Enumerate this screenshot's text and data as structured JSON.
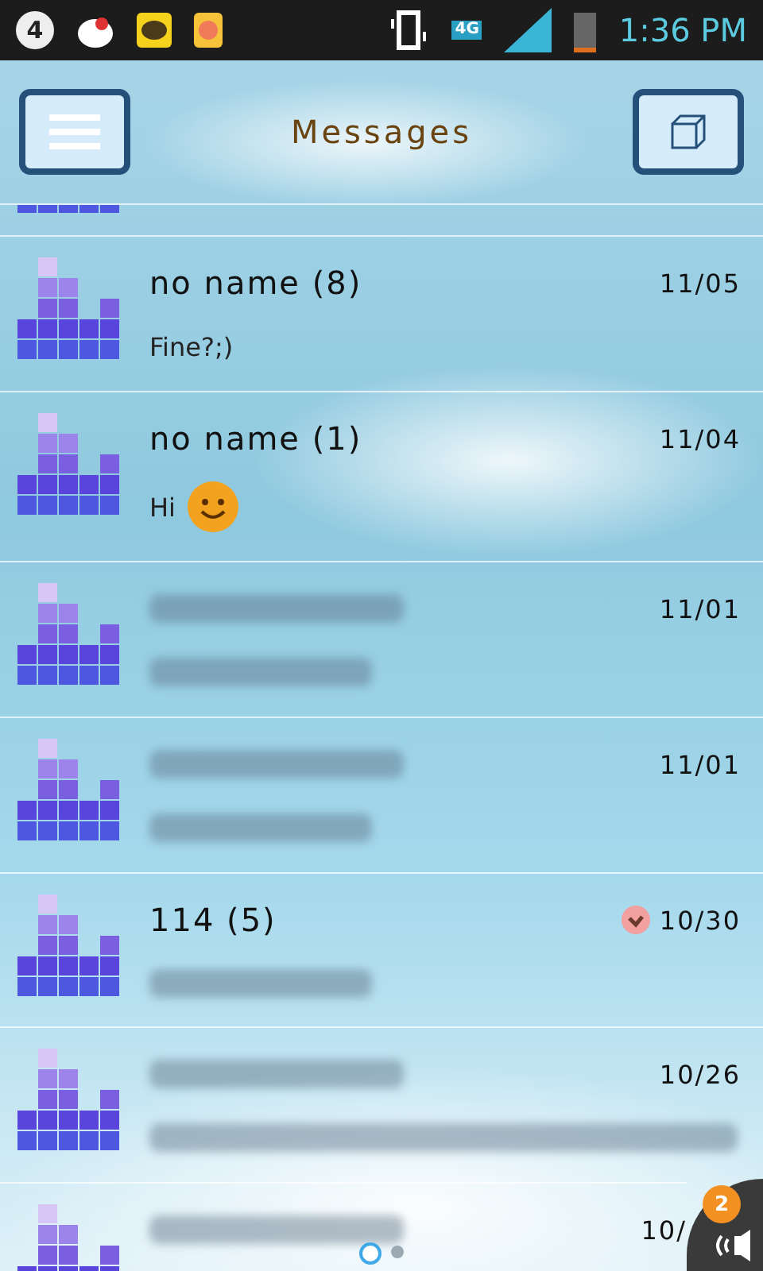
{
  "status_bar": {
    "alarm_badge": "4",
    "network": "4G",
    "time": "1:36 PM"
  },
  "header": {
    "title": "Messages"
  },
  "threads": [
    {
      "name": "no name (8)",
      "preview": "Fine?;)",
      "date": "11/05",
      "emoticon": false,
      "flagged": false
    },
    {
      "name": "no name (1)",
      "preview": "Hi",
      "date": "11/04",
      "emoticon": true,
      "flagged": false
    },
    {
      "date": "11/01",
      "emoticon": false,
      "flagged": false
    },
    {
      "date": "11/01",
      "emoticon": false,
      "flagged": false
    },
    {
      "name": "114 (5)",
      "date": "10/30",
      "emoticon": false,
      "flagged": true
    },
    {
      "date": "10/26",
      "emoticon": false,
      "flagged": false
    },
    {
      "date": "10/",
      "emoticon": false,
      "flagged": false
    }
  ],
  "pager": [
    {
      "selected": true
    },
    {
      "selected": false
    }
  ],
  "floating_widget": {
    "badge": "2"
  }
}
